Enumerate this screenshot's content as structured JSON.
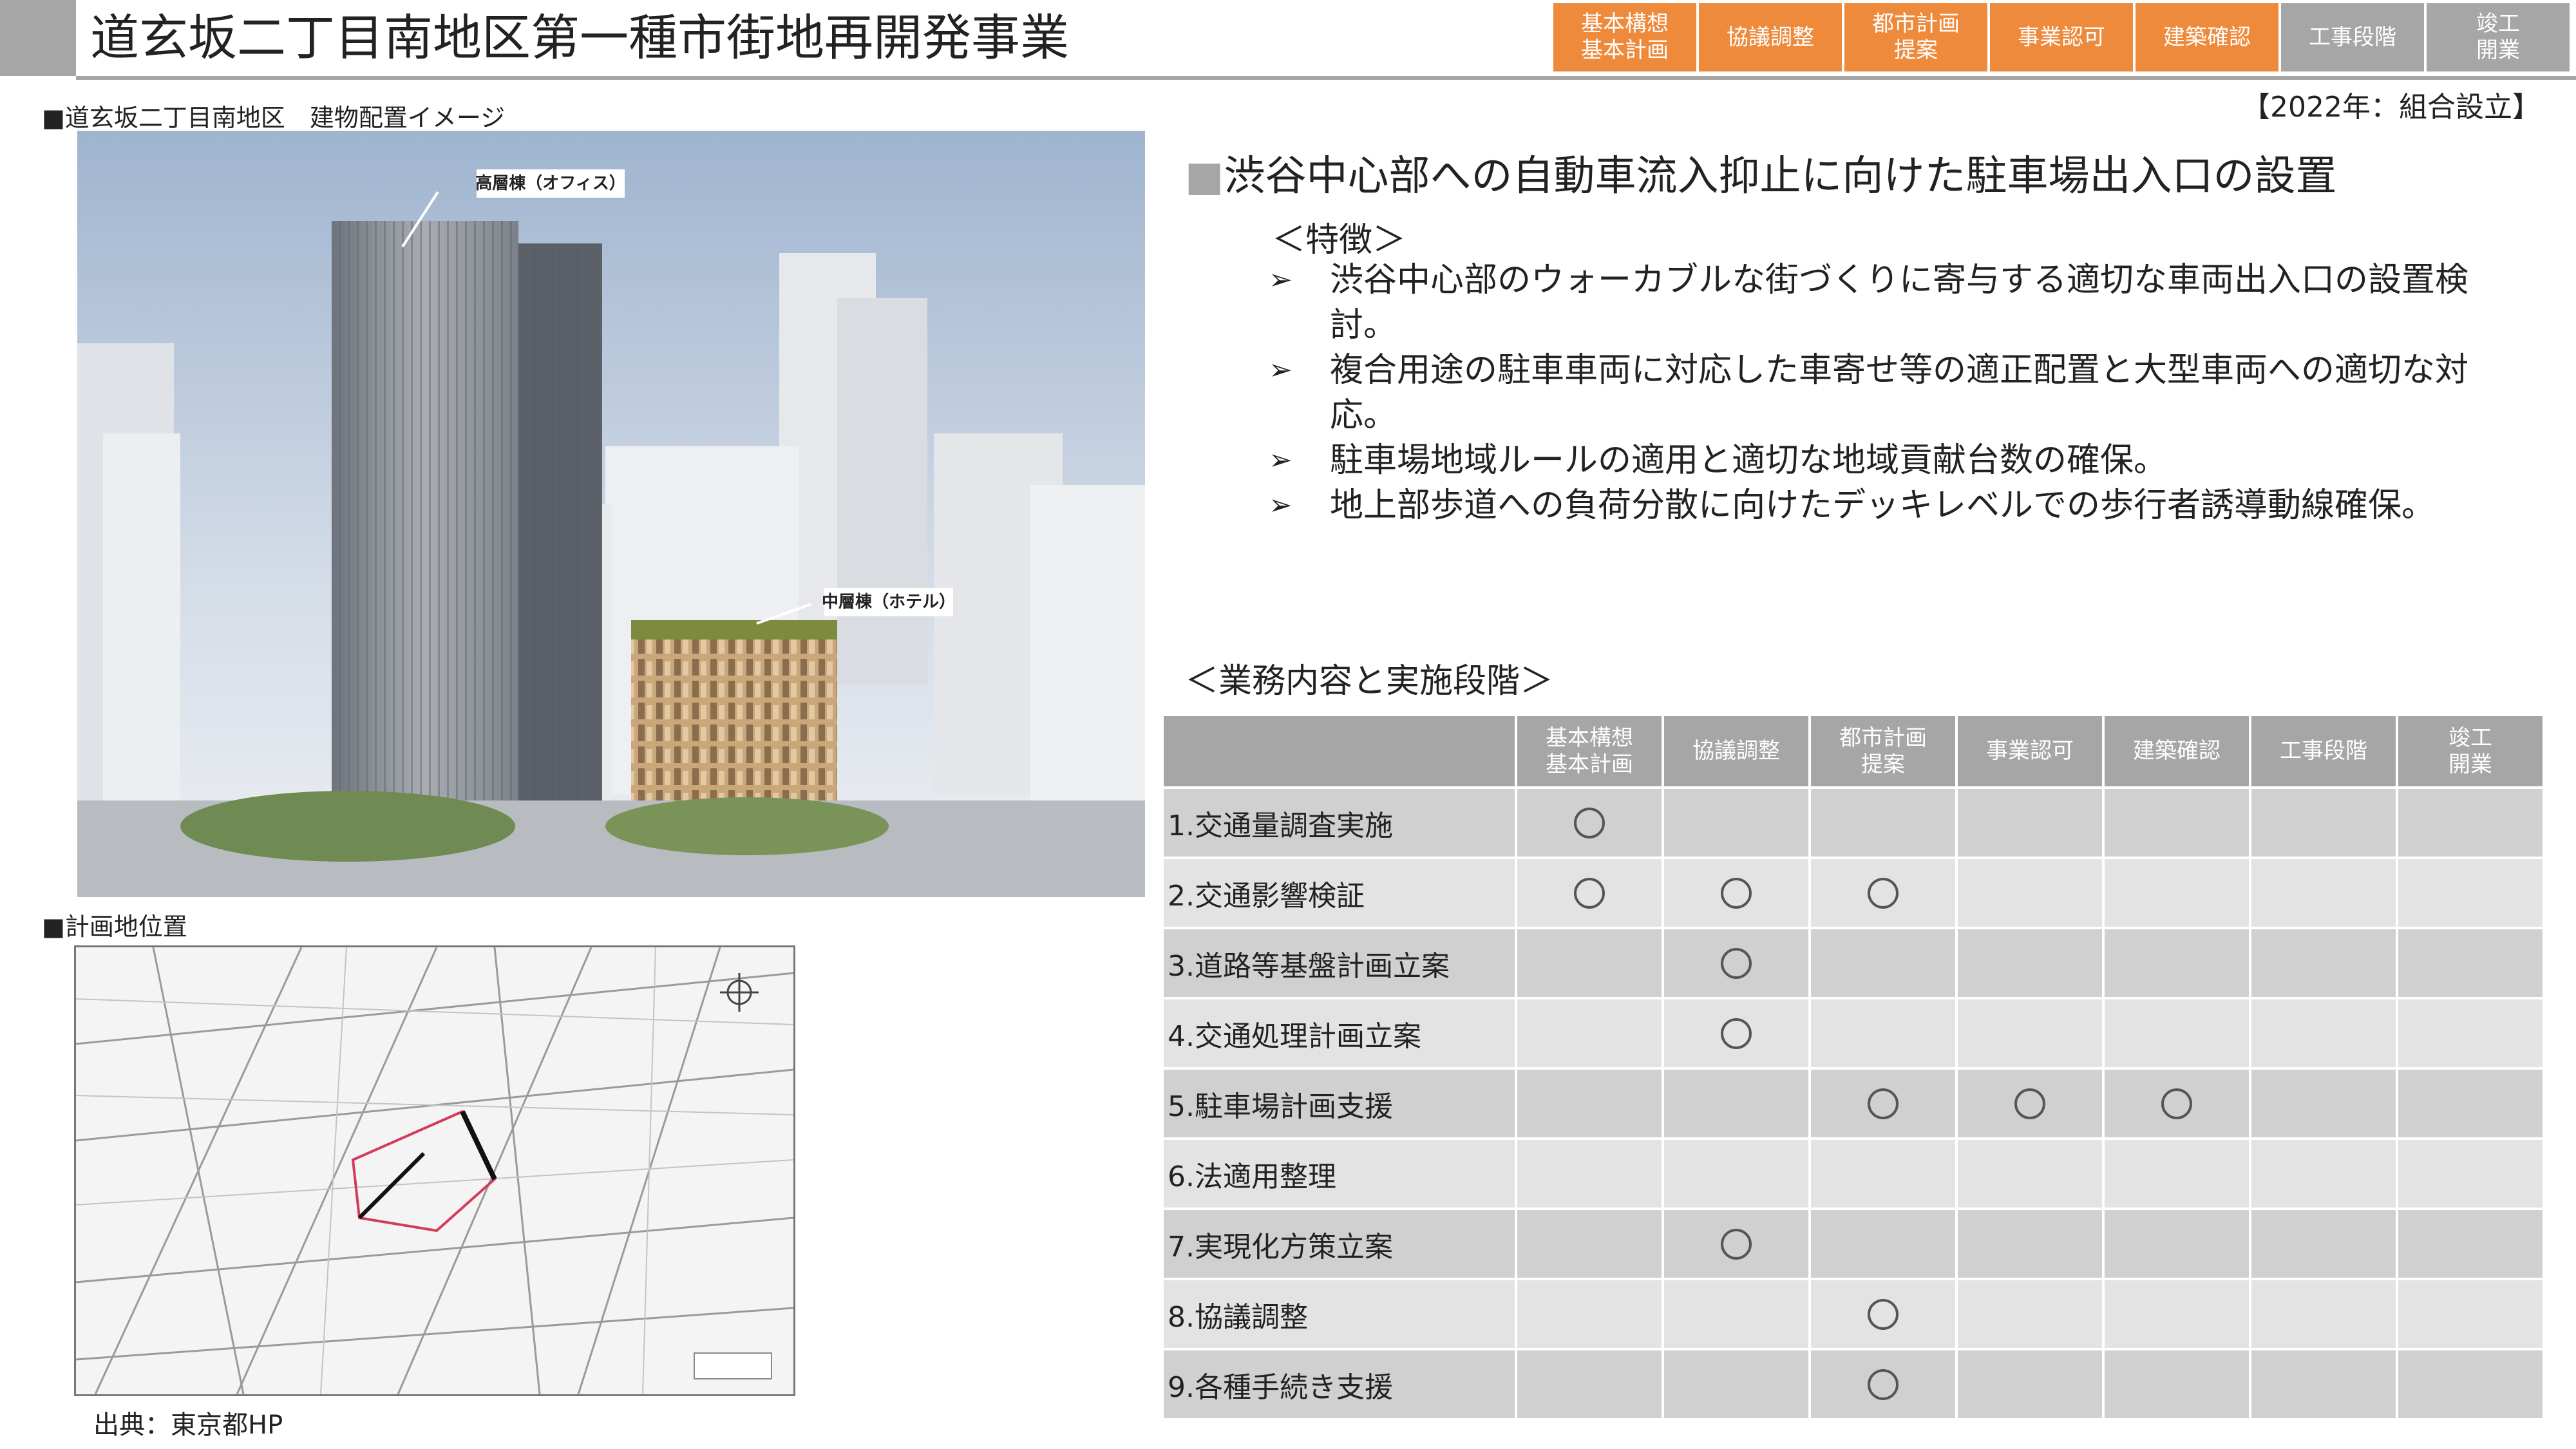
{
  "header": {
    "title": "道玄坂二丁目南地区第一種市街地再開発事業",
    "stages": [
      {
        "label": "基本構想\n基本計画",
        "active": true
      },
      {
        "label": "協議調整",
        "active": true
      },
      {
        "label": "都市計画\n提案",
        "active": true
      },
      {
        "label": "事業認可",
        "active": true
      },
      {
        "label": "建築確認",
        "active": true
      },
      {
        "label": "工事段階",
        "active": false
      },
      {
        "label": "竣工\n開業",
        "active": false
      }
    ],
    "established": "【2022年：組合設立】"
  },
  "left": {
    "photo_caption": "■道玄坂二丁目南地区　建物配置イメージ",
    "photo_labels": {
      "high_rise": "高層棟（オフィス）",
      "mid_rise": "中層棟（ホテル）"
    },
    "map_caption": "■計画地位置",
    "source": "出典：東京都HP"
  },
  "main": {
    "heading_mark": "■",
    "heading": "渋谷中心部への自動車流入抑止に向けた駐車場出入口の設置",
    "features_title": "＜特徴＞",
    "bullet_glyph": "➢",
    "bullets": [
      "渋谷中心部のウォーカブルな街づくりに寄与する適切な車両出入口の設置検討。",
      "複合用途の駐車車両に対応した車寄せ等の適正配置と大型車両への適切な対応。",
      "駐車場地域ルールの適用と適切な地域貢献台数の確保。",
      "地上部歩道への負荷分散に向けたデッキレベルでの歩行者誘導動線確保。"
    ],
    "business_title": "＜業務内容と実施段階＞"
  },
  "table": {
    "headers": [
      "",
      "基本構想\n基本計画",
      "協議調整",
      "都市計画\n提案",
      "事業認可",
      "建築確認",
      "工事段階",
      "竣工\n開業"
    ],
    "rows": [
      {
        "label": "1.交通量調査実施",
        "marks": [
          true,
          false,
          false,
          false,
          false,
          false,
          false
        ]
      },
      {
        "label": "2.交通影響検証",
        "marks": [
          true,
          true,
          true,
          false,
          false,
          false,
          false
        ]
      },
      {
        "label": "3.道路等基盤計画立案",
        "marks": [
          false,
          true,
          false,
          false,
          false,
          false,
          false
        ]
      },
      {
        "label": "4.交通処理計画立案",
        "marks": [
          false,
          true,
          false,
          false,
          false,
          false,
          false
        ]
      },
      {
        "label": "5.駐車場計画支援",
        "marks": [
          false,
          false,
          true,
          true,
          true,
          false,
          false
        ]
      },
      {
        "label": "6.法適用整理",
        "marks": [
          false,
          false,
          false,
          false,
          false,
          false,
          false
        ]
      },
      {
        "label": "7.実現化方策立案",
        "marks": [
          false,
          true,
          false,
          false,
          false,
          false,
          false
        ]
      },
      {
        "label": "8.協議調整",
        "marks": [
          false,
          false,
          true,
          false,
          false,
          false,
          false
        ]
      },
      {
        "label": "9.各種手続き支援",
        "marks": [
          false,
          false,
          true,
          false,
          false,
          false,
          false
        ]
      }
    ]
  },
  "colors": {
    "accent": "#ee8a3c",
    "grey": "#a6a6a6",
    "row_dark": "#d0d0d0",
    "row_light": "#e3e3e3"
  }
}
